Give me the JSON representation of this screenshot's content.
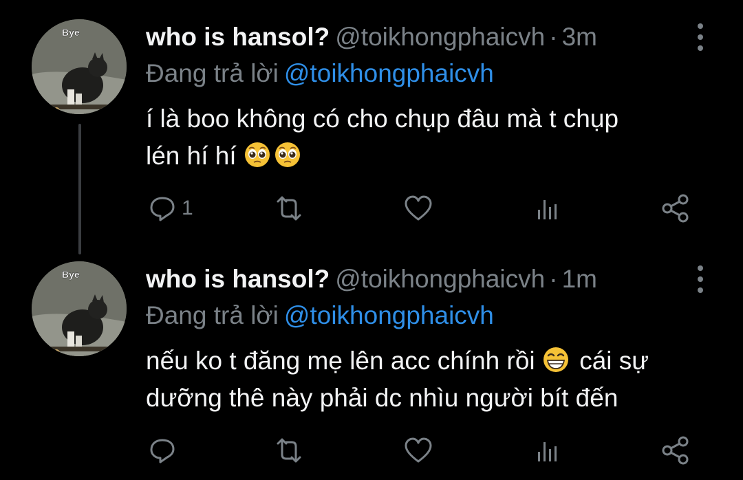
{
  "tweets": [
    {
      "avatar_text": "Bye",
      "display_name": "who is hansol?",
      "handle": "@toikhongphaicvh",
      "separator": "·",
      "time": "3m",
      "reply_prefix": "Đang trả lời",
      "reply_mention": "@toikhongphaicvh",
      "text_line1": "í là boo không có cho chụp đâu mà t chụp",
      "text_line2": "lén hí hí",
      "emojis": [
        "pleading-face",
        "pleading-face"
      ],
      "reply_count": "1"
    },
    {
      "avatar_text": "Bye",
      "display_name": "who is hansol?",
      "handle": "@toikhongphaicvh",
      "separator": "·",
      "time": "1m",
      "reply_prefix": "Đang trả lời",
      "reply_mention": "@toikhongphaicvh",
      "text_line1_a": "nếu ko t đăng mẹ lên acc chính rồi",
      "text_line1_b": "cái sự",
      "text_line2": "dưỡng thê này phải dc nhìu người bít đến",
      "emojis": [
        "grinning-face"
      ],
      "reply_count": ""
    }
  ],
  "colors": {
    "background": "#000000",
    "text": "#f2f3f4",
    "muted": "#7b8288",
    "link": "#2f8fe8",
    "thread_line": "#3a3d41"
  }
}
